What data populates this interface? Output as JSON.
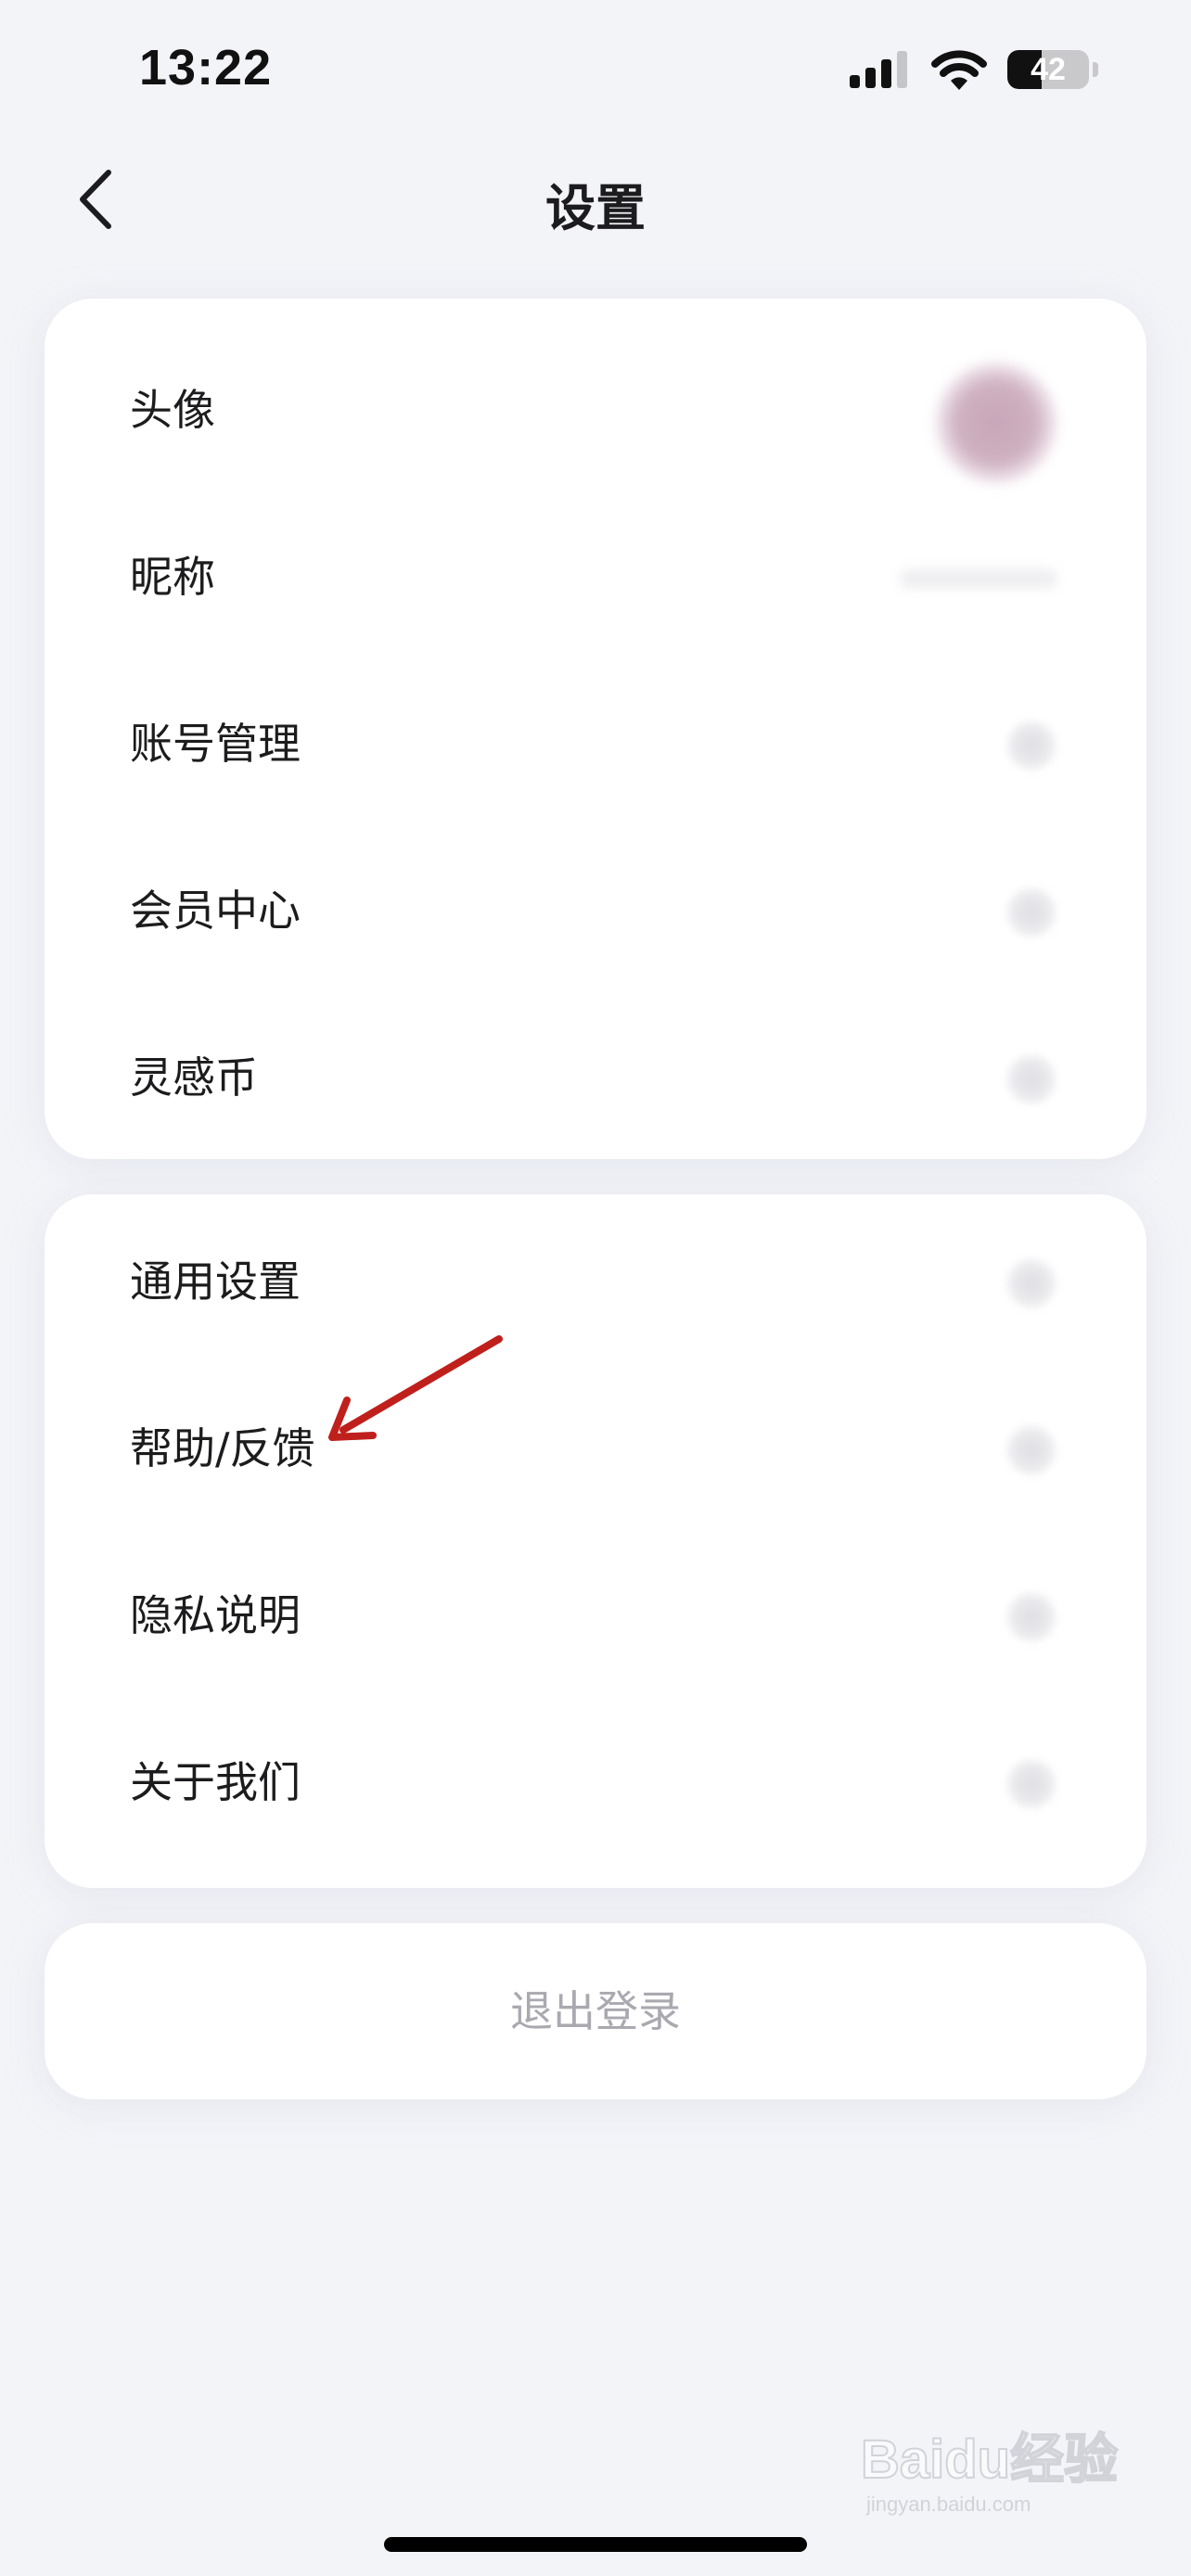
{
  "status_bar": {
    "time": "13:22",
    "battery_level": "42",
    "battery_fraction": 0.42,
    "icons": [
      "signal-icon",
      "wifi-icon",
      "battery-icon"
    ]
  },
  "nav": {
    "title": "设置",
    "back_icon": "chevron-left-icon"
  },
  "profile_section": {
    "items": [
      {
        "label": "头像",
        "trailing": "avatar"
      },
      {
        "label": "昵称",
        "trailing": "nickname-value"
      },
      {
        "label": "账号管理",
        "trailing": "chevron-right-icon"
      },
      {
        "label": "会员中心",
        "trailing": "chevron-right-icon"
      },
      {
        "label": "灵感币",
        "trailing": "chevron-right-icon"
      }
    ]
  },
  "general_section": {
    "items": [
      {
        "label": "通用设置",
        "trailing": "chevron-right-icon"
      },
      {
        "label": "帮助/反馈",
        "trailing": "chevron-right-icon"
      },
      {
        "label": "隐私说明",
        "trailing": "chevron-right-icon"
      },
      {
        "label": "关于我们",
        "trailing": "chevron-right-icon"
      }
    ]
  },
  "logout": {
    "label": "退出登录"
  },
  "annotation": {
    "target": "帮助/反馈",
    "color": "#c0201c"
  },
  "watermark": {
    "text": "Baidu经验",
    "subtext": "jingyan.baidu.com"
  },
  "colors": {
    "background": "#f3f4f8",
    "card": "#ffffff",
    "text": "#1c1c1e",
    "logout_text": "#a9a9b0"
  }
}
